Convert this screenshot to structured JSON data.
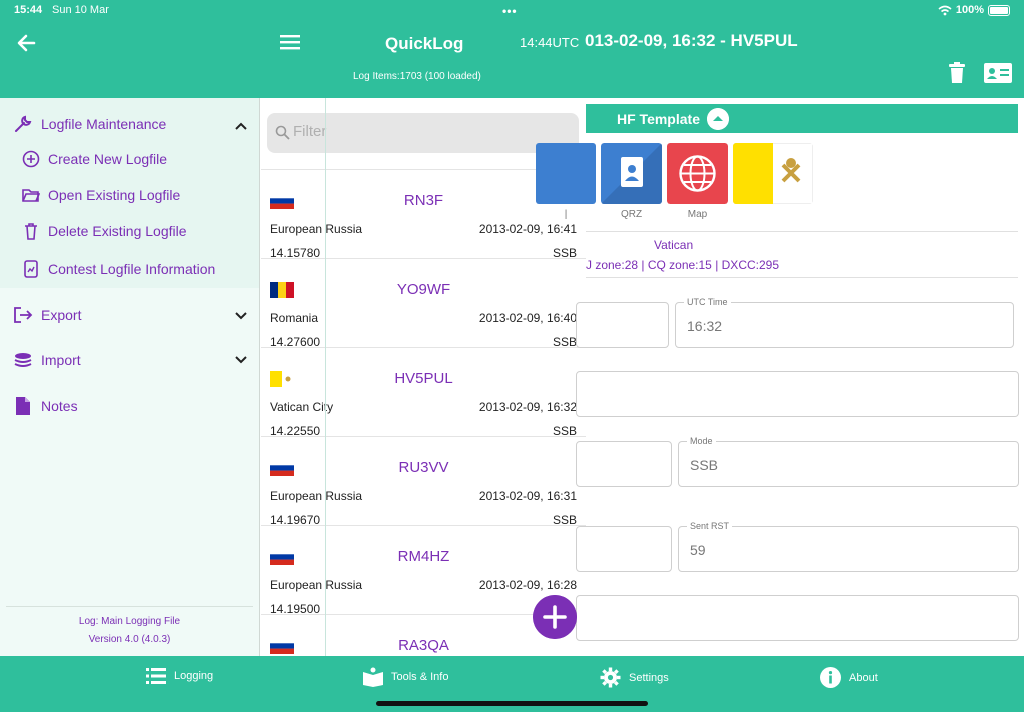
{
  "status": {
    "time": "15:44",
    "date": "Sun 10 Mar",
    "battery": "100%"
  },
  "header": {
    "app_title": "QuickLog",
    "utc": "14:44UTC",
    "entry_title": "013-02-09, 16:32 - HV5PUL",
    "log_items": "Log Items:1703 (100 loaded)"
  },
  "sidebar": {
    "maintenance": {
      "label": "Logfile Maintenance",
      "items": [
        {
          "label": "Create New Logfile",
          "icon": "plus-circle-icon"
        },
        {
          "label": "Open Existing Logfile",
          "icon": "folder-open-icon"
        },
        {
          "label": "Delete Existing Logfile",
          "icon": "trash-icon"
        },
        {
          "label": "Contest Logfile Information",
          "icon": "contest-info-icon"
        }
      ]
    },
    "export_label": "Export",
    "import_label": "Import",
    "notes_label": "Notes",
    "footer": {
      "log": "Log: Main Logging File",
      "version": "Version 4.0 (4.0.3)"
    }
  },
  "list": {
    "filter_placeholder": "Filter",
    "entries": [
      {
        "call": "RN3F",
        "country": "European Russia",
        "datetime": "2013-02-09, 16:41",
        "freq": "14.15780",
        "mode": "SSB",
        "flag": "russia"
      },
      {
        "call": "YO9WF",
        "country": "Romania",
        "datetime": "2013-02-09, 16:40",
        "freq": "14.27600",
        "mode": "SSB",
        "flag": "romania"
      },
      {
        "call": "HV5PUL",
        "country": "Vatican City",
        "datetime": "2013-02-09, 16:32",
        "freq": "14.22550",
        "mode": "SSB",
        "flag": "vatican"
      },
      {
        "call": "RU3VV",
        "country": "European Russia",
        "datetime": "2013-02-09, 16:31",
        "freq": "14.19670",
        "mode": "SSB",
        "flag": "russia"
      },
      {
        "call": "RM4HZ",
        "country": "European Russia",
        "datetime": "2013-02-09, 16:28",
        "freq": "14.19500",
        "mode": "",
        "flag": "russia"
      },
      {
        "call": "RA3QA",
        "country": "",
        "datetime": "",
        "freq": "",
        "mode": "",
        "flag": "russia"
      }
    ]
  },
  "detail": {
    "template_label": "HF Template",
    "tiles": [
      {
        "label": "",
        "icon": "partial-tile-icon"
      },
      {
        "label": "QRZ",
        "icon": "contact-book-icon"
      },
      {
        "label": "Map",
        "icon": "globe-icon"
      },
      {
        "label": "",
        "icon": "vatican-flag-icon"
      }
    ],
    "country": "Vatican",
    "zones": "J zone:28 | CQ zone:15 | DXCC:295",
    "utc_time_label": "UTC Time",
    "utc_time_value": "16:32",
    "mode_label": "Mode",
    "mode_value": "SSB",
    "sent_rst_label": "Sent RST",
    "sent_rst_value": "59"
  },
  "tabs": [
    {
      "label": "Logging",
      "icon": "list-icon"
    },
    {
      "label": "Tools & Info",
      "icon": "book-icon"
    },
    {
      "label": "Settings",
      "icon": "gear-icon"
    },
    {
      "label": "About",
      "icon": "info-icon"
    }
  ],
  "colors": {
    "accent": "#2fbf9c",
    "purple": "#7b2fb5"
  }
}
